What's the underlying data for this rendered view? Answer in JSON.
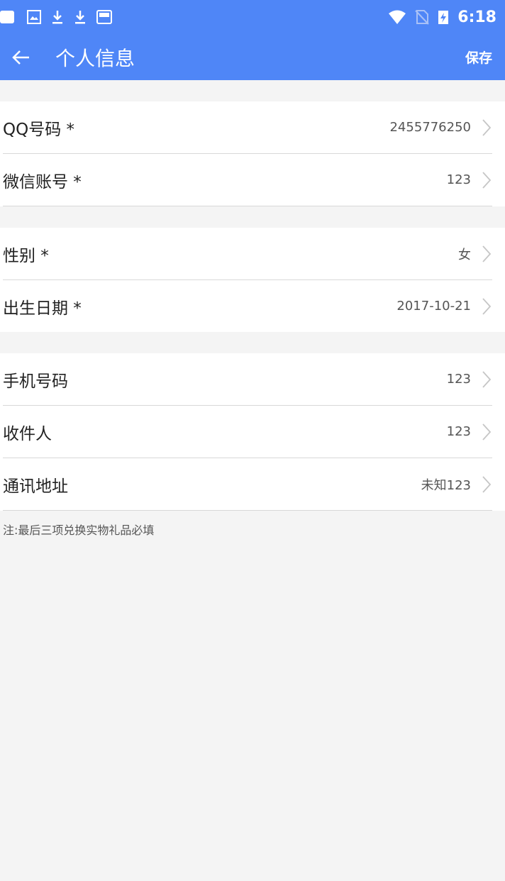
{
  "status_bar": {
    "time": "6:18",
    "icons": [
      "notification-square-icon",
      "image-icon",
      "download-icon",
      "download-icon",
      "screen-icon",
      "wifi-icon",
      "no-sim-icon",
      "battery-charging-icon"
    ]
  },
  "header": {
    "title": "个人信息",
    "save_label": "保存",
    "back_icon": "arrow-left-icon",
    "color": "#4f86f7"
  },
  "groups": [
    {
      "rows": [
        {
          "label": "QQ号码 *",
          "value": "2455776250"
        },
        {
          "label": "微信账号 *",
          "value": "123"
        }
      ]
    },
    {
      "rows": [
        {
          "label": "性别 *",
          "value": "女"
        },
        {
          "label": "出生日期 *",
          "value": "2017-10-21"
        }
      ]
    },
    {
      "rows": [
        {
          "label": "手机号码",
          "value": "123"
        },
        {
          "label": "收件人",
          "value": "123"
        },
        {
          "label": "通讯地址",
          "value": "未知123"
        }
      ]
    }
  ],
  "note": "注:最后三项兑换实物礼品必填"
}
